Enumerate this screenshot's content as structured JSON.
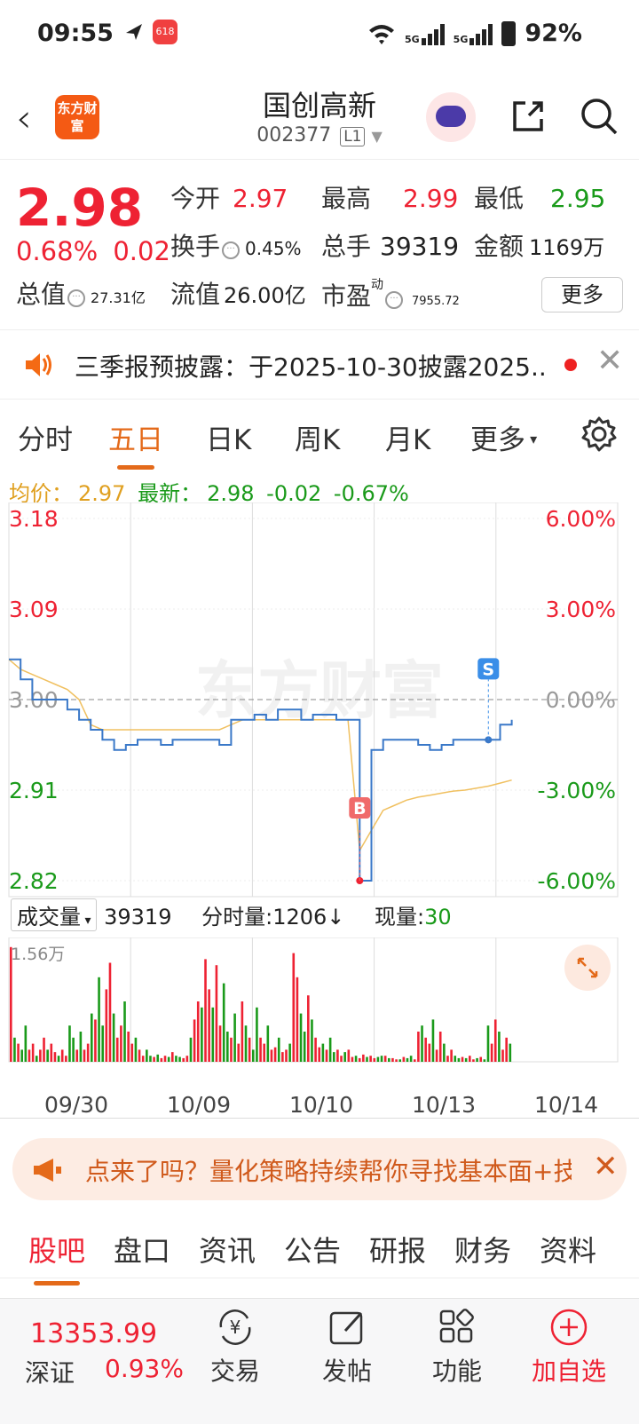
{
  "status": {
    "time": "09:55",
    "battery": "92%",
    "net1": "5G",
    "net2": "5G",
    "app_badge": "618"
  },
  "header": {
    "back": "‹",
    "logo": "东方财富",
    "stock_name": "国创高新",
    "stock_code": "002377",
    "level": "L1"
  },
  "quote": {
    "price": "2.98",
    "change_pct": "0.68%",
    "change_amt": "0.02",
    "open_label": "今开",
    "open": "2.97",
    "high_label": "最高",
    "high": "2.99",
    "low_label": "最低",
    "low": "2.95",
    "turnover_label": "换手",
    "turnover": "0.45%",
    "volume_label": "总手",
    "volume": "39319",
    "amount_label": "金额",
    "amount": "1169万",
    "mktcap_label": "总值",
    "mktcap": "27.31亿",
    "float_label": "流值",
    "float": "26.00亿",
    "pe_label": "市盈",
    "pe_sup": "动",
    "pe": "7955.72",
    "more": "更多"
  },
  "notice": {
    "text": "三季报预披露：于2025-10-30披露2025..."
  },
  "chart_tabs": [
    "分时",
    "五日",
    "日K",
    "周K",
    "月K",
    "更多"
  ],
  "avg_line": {
    "avg_label": "均价：",
    "avg": "2.97",
    "latest_label": "最新：",
    "latest": "2.98",
    "chg": "-0.02",
    "chg_pct": "-0.67%"
  },
  "chart_data": {
    "type": "line",
    "x_labels": [
      "09/30",
      "10/09",
      "10/10",
      "10/13",
      "10/14"
    ],
    "y_left_ticks": [
      "3.18",
      "3.09",
      "3.00",
      "2.91",
      "2.82"
    ],
    "y_right_ticks": [
      "6.00%",
      "3.00%",
      "0.00%",
      "-3.00%",
      "-6.00%"
    ],
    "ylim": [
      2.82,
      3.18
    ],
    "reference": 3.0,
    "series": [
      {
        "name": "最新",
        "color": "#3a78c8",
        "values": [
          3.04,
          3.02,
          3.0,
          3.0,
          3.0,
          2.99,
          2.98,
          2.97,
          2.96,
          2.95,
          2.955,
          2.96,
          2.96,
          2.955,
          2.96,
          2.96,
          2.96,
          2.96,
          2.955,
          2.98,
          2.98,
          2.985,
          2.98,
          2.99,
          2.99,
          2.98,
          2.985,
          2.985,
          2.98,
          2.98,
          2.82,
          2.95,
          2.96,
          2.96,
          2.96,
          2.955,
          2.95,
          2.955,
          2.96,
          2.96,
          2.96,
          2.96,
          2.975,
          2.98
        ]
      },
      {
        "name": "均价",
        "color": "#f0c060",
        "values": [
          3.04,
          3.03,
          3.025,
          3.02,
          3.015,
          3.01,
          3.0,
          2.975,
          2.97,
          2.97,
          2.97,
          2.97,
          2.97,
          2.97,
          2.97,
          2.97,
          2.97,
          2.97,
          2.97,
          2.975,
          2.98,
          2.98,
          2.98,
          2.98,
          2.98,
          2.98,
          2.98,
          2.98,
          2.98,
          2.98,
          2.85,
          2.87,
          2.89,
          2.895,
          2.9,
          2.903,
          2.905,
          2.907,
          2.909,
          2.91,
          2.912,
          2.914,
          2.917,
          2.92
        ]
      }
    ],
    "markers": [
      {
        "label": "B",
        "color": "#f06a6a"
      },
      {
        "label": "S",
        "color": "#3a8ee8"
      }
    ],
    "watermark": "东方财富"
  },
  "volume": {
    "selector": "成交量",
    "total": "39319",
    "per_min_label": "分时量:",
    "per_min": "1206↓",
    "current_label": "现量:",
    "current": "30",
    "max_label": "1.56万",
    "bars": [
      0.95,
      0.2,
      0.15,
      0.1,
      0.3,
      0.1,
      0.15,
      0.05,
      0.1,
      0.2,
      0.1,
      0.15,
      0.08,
      0.05,
      0.1,
      0.05,
      0.3,
      0.2,
      0.1,
      0.25,
      0.1,
      0.15,
      0.4,
      0.35,
      0.7,
      0.3,
      0.6,
      0.82,
      0.4,
      0.2,
      0.3,
      0.5,
      0.25,
      0.15,
      0.2,
      0.1,
      0.05,
      0.1,
      0.05,
      0.04,
      0.06,
      0.03,
      0.05,
      0.04,
      0.08,
      0.05,
      0.04,
      0.03,
      0.05,
      0.2,
      0.35,
      0.5,
      0.45,
      0.85,
      0.6,
      0.45,
      0.8,
      0.3,
      0.65,
      0.25,
      0.2,
      0.4,
      0.15,
      0.5,
      0.3,
      0.2,
      0.1,
      0.45,
      0.2,
      0.15,
      0.3,
      0.1,
      0.12,
      0.2,
      0.08,
      0.1,
      0.15,
      0.9,
      0.7,
      0.4,
      0.25,
      0.55,
      0.35,
      0.2,
      0.12,
      0.15,
      0.1,
      0.2,
      0.08,
      0.1,
      0.05,
      0.08,
      0.1,
      0.04,
      0.05,
      0.03,
      0.06,
      0.04,
      0.05,
      0.03,
      0.04,
      0.05,
      0.05,
      0.03,
      0.03,
      0.02,
      0.02,
      0.04,
      0.03,
      0.05,
      0.02,
      0.25,
      0.3,
      0.2,
      0.15,
      0.35,
      0.1,
      0.25,
      0.15,
      0.05,
      0.1,
      0.05,
      0.03,
      0.04,
      0.03,
      0.05,
      0.02,
      0.03,
      0.04,
      0.02,
      0.3,
      0.15,
      0.35,
      0.25,
      0.1,
      0.2,
      0.15
    ]
  },
  "dates": [
    "09/30",
    "10/09",
    "10/10",
    "10/13",
    "10/14"
  ],
  "promo": {
    "text": "点来了吗？量化策略持续帮你寻找基本面+技"
  },
  "bottom_tabs": [
    "股吧",
    "盘口",
    "资讯",
    "公告",
    "研报",
    "财务",
    "资料"
  ],
  "bottombar": {
    "index_value": "13353.99",
    "index_name": "深证",
    "index_pct": "0.93%",
    "trade": "交易",
    "post": "发帖",
    "func": "功能",
    "add": "加自选",
    "trade_icon_text": "¥"
  }
}
